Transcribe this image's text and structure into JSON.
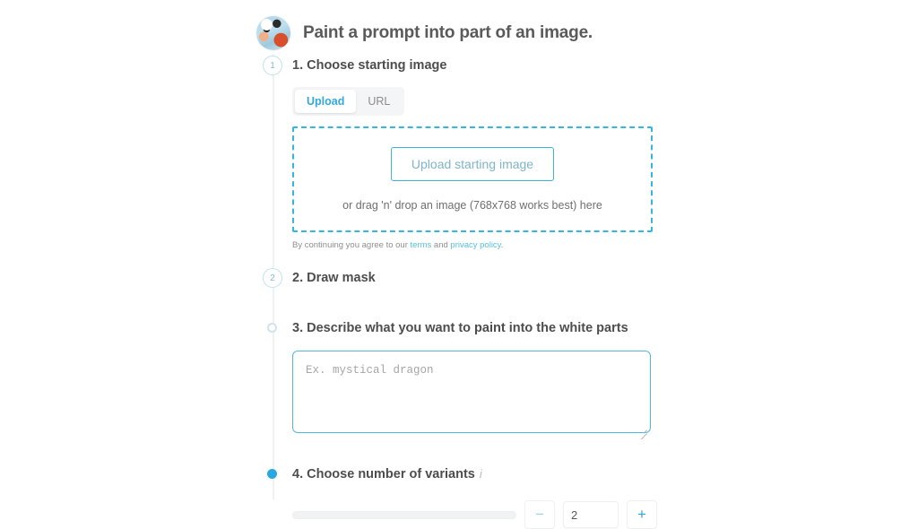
{
  "header": {
    "title": "Paint a prompt into part of an image.",
    "avatar_name": "user-avatar"
  },
  "steps": [
    {
      "marker": "1",
      "title": "1. Choose starting image"
    },
    {
      "marker": "2",
      "title": "2. Draw mask"
    },
    {
      "marker": "",
      "title": "3. Describe what you want to paint into the white parts"
    },
    {
      "marker": "",
      "title": "4. Choose number of variants",
      "info_icon": "i"
    }
  ],
  "source_tabs": {
    "upload_label": "Upload",
    "url_label": "URL",
    "active": "Upload"
  },
  "dropzone": {
    "button_label": "Upload starting image",
    "hint": "or drag 'n' drop an image (768x768 works best) here"
  },
  "terms": {
    "prefix": "By continuing you agree to our ",
    "terms_link": "terms",
    "middle": " and ",
    "privacy_link": "privacy policy",
    "suffix": "."
  },
  "prompt": {
    "placeholder": "Ex. mystical dragon",
    "value": ""
  },
  "variants": {
    "value": "2",
    "minus_label": "−",
    "plus_label": "+",
    "slider_value": 2
  },
  "colors": {
    "accent_blue": "#29a8e0",
    "cyan_border": "#37b6dd",
    "link_blue": "#56c0e3",
    "rail_gray": "#f0f1f2",
    "title_gray": "#5a5a5a"
  }
}
